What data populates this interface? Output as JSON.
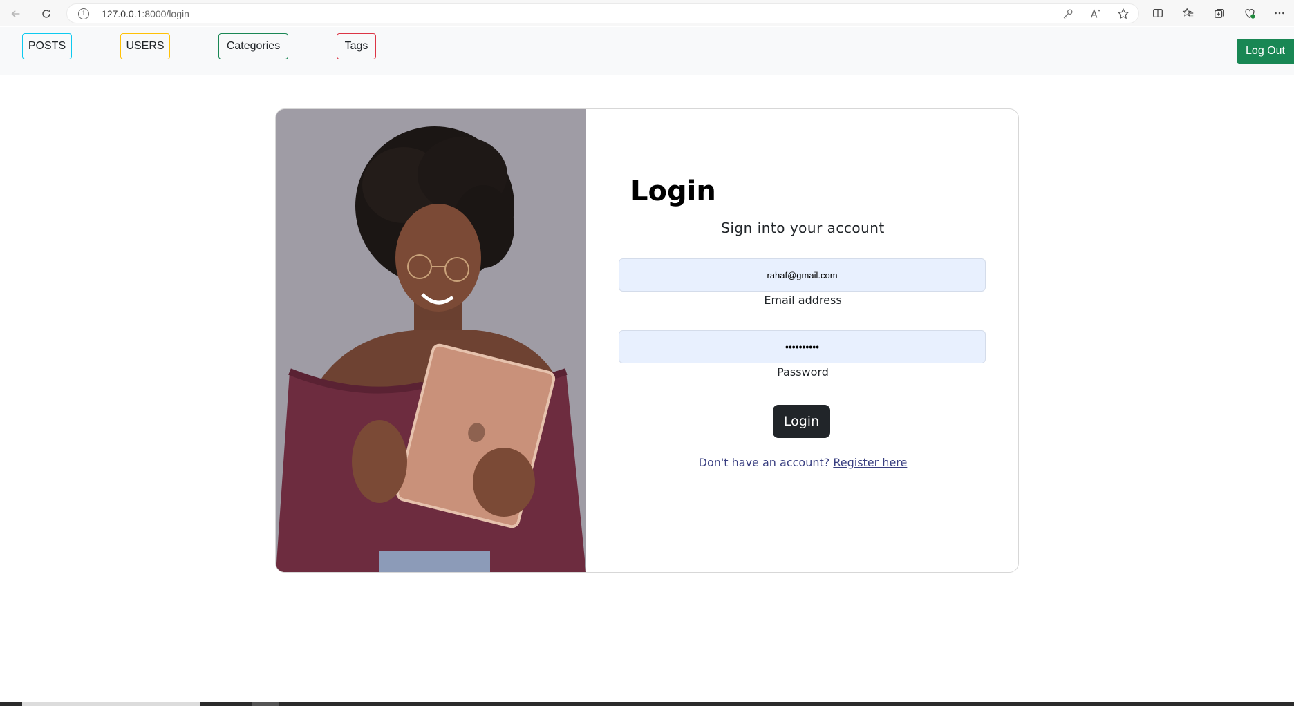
{
  "browser": {
    "url_host": "127.0.0.1",
    "url_path": ":8000/login"
  },
  "navbar": {
    "posts_label": "POSTS",
    "users_label": "USERS",
    "categories_label": "Categories",
    "tags_label": "Tags",
    "logout_label": "Log Out",
    "colors": {
      "posts": "#0dcaf0",
      "users": "#ffc107",
      "categories": "#198754",
      "tags": "#dc3545",
      "logout": "#198754"
    }
  },
  "login": {
    "title": "Login",
    "subtitle": "Sign into your account",
    "email_value": "rahaf@gmail.com",
    "email_label": "Email address",
    "password_value": "••••••••••",
    "password_label": "Password",
    "submit_label": "Login",
    "register_prompt": "Don't have an account?",
    "register_link": "Register here"
  }
}
